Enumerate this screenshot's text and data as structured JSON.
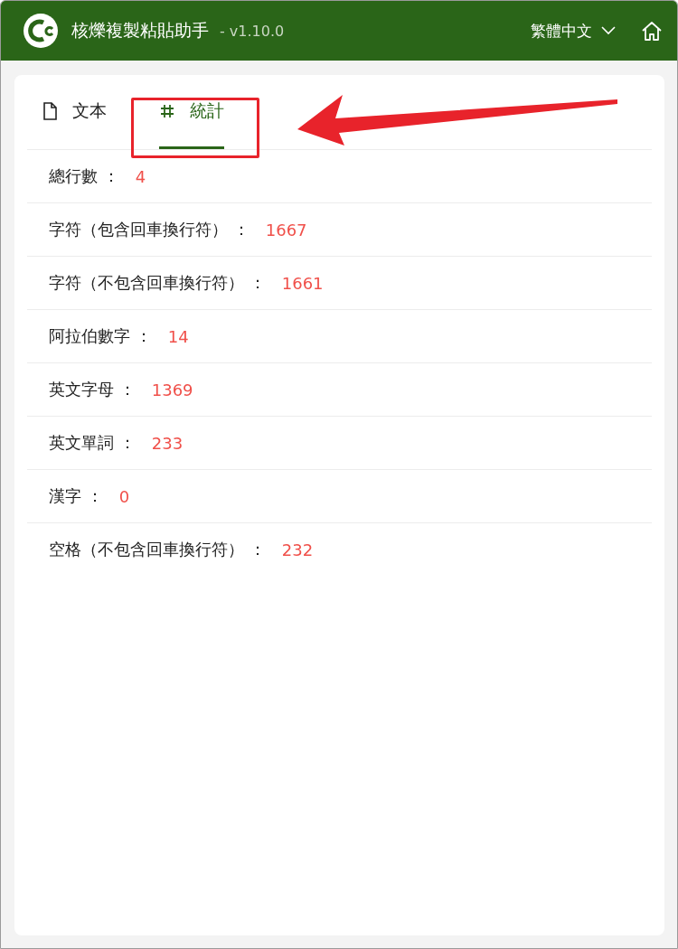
{
  "header": {
    "title": "核爍複製粘貼助手",
    "version": "- v1.10.0",
    "language": "繁體中文"
  },
  "tabs": [
    {
      "label": "文本",
      "kind": "file",
      "selected": false
    },
    {
      "label": "統計",
      "kind": "hash",
      "selected": true
    }
  ],
  "stats": [
    {
      "label": "總行數 ：",
      "value": "4"
    },
    {
      "label": "字符（包含回車換行符） ：",
      "value": "1667"
    },
    {
      "label": "字符（不包含回車換行符） ：",
      "value": "1661"
    },
    {
      "label": "阿拉伯數字 ：",
      "value": "14"
    },
    {
      "label": "英文字母 ：",
      "value": "1369"
    },
    {
      "label": "英文單詞 ：",
      "value": "233"
    },
    {
      "label": "漢字 ：",
      "value": "0"
    },
    {
      "label": "空格（不包含回車換行符） ：",
      "value": "232"
    }
  ]
}
